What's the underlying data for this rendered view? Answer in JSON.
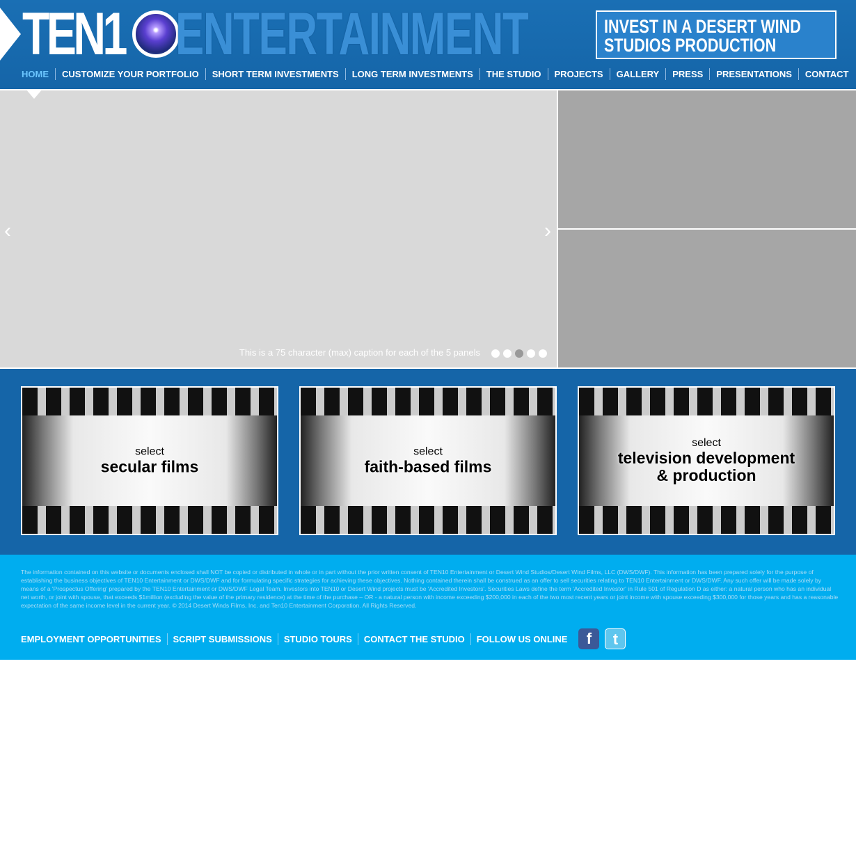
{
  "header": {
    "logo_ten": "TEN1",
    "logo_ent": "ENTERTAINMENT",
    "invest_line1": "INVEST IN A DESERT WIND",
    "invest_line2": "STUDIOS PRODUCTION"
  },
  "nav": [
    "HOME",
    "CUSTOMIZE YOUR PORTFOLIO",
    "SHORT TERM INVESTMENTS",
    "LONG TERM INVESTMENTS",
    "THE STUDIO",
    "PROJECTS",
    "GALLERY",
    "PRESS",
    "PRESENTATIONS",
    "CONTACT"
  ],
  "slider": {
    "caption": "This is a 75 character (max) caption for each of the 5 panels",
    "prev": "‹",
    "next": "›",
    "active_dot": 3
  },
  "cards": [
    {
      "select": "select",
      "title": "secular films"
    },
    {
      "select": "select",
      "title": "faith-based films"
    },
    {
      "select": "select",
      "title": "television development & production"
    }
  ],
  "footer": {
    "legal": "The information contained on this website or documents enclosed shall NOT be copied or distributed in whole or in part without the prior written consent of TEN10 Entertainment or Desert Wind Studios/Desert Wind Films, LLC (DWS/DWF).  This information has been prepared solely for the purpose of establishing the business objectives of TEN10 Entertainment or DWS/DWF and for formulating specific strategies for achieving these objectives. Nothing contained therein shall be construed as an offer to sell securities relating to TEN10 Entertainment or DWS/DWF.  Any such offer will be made solely by means of a 'Prospectus Offering' prepared by the TEN10 Entertainment or DWS/DWF Legal Team. Investors into TEN10 or Desert Wind projects must be 'Accredited Investors'. Securities Laws define the term 'Accredited Investor' in Rule 501 of Regulation D as either: a natural person who has an individual net worth, or joint with spouse, that exceeds $1million (excluding the value of the primary residence) at the time of the purchase – OR - a natural person with income exceeding $200,000 in each of the two most recent years or joint income with spouse exceeding $300,000 for those years and has a reasonable expectation of the same income level in the current year.    © 2014 Desert Winds Films, Inc. and Ten10 Entertainment Corporation. All Rights Reserved.",
    "links": [
      "EMPLOYMENT OPPORTUNITIES",
      "SCRIPT SUBMISSIONS",
      "STUDIO TOURS",
      "CONTACT THE STUDIO",
      "FOLLOW US ONLINE"
    ],
    "facebook": "f",
    "twitter": "t"
  },
  "colors": {
    "header": "#1565a8",
    "footer": "#00adef",
    "nav_active": "#6cc6ff"
  }
}
